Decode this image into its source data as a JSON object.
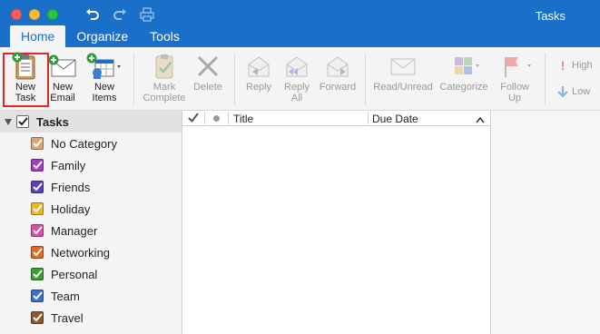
{
  "window": {
    "title": "Tasks"
  },
  "tabs": [
    {
      "label": "Home",
      "active": true
    },
    {
      "label": "Organize",
      "active": false
    },
    {
      "label": "Tools",
      "active": false
    }
  ],
  "ribbon": {
    "new_task": {
      "line1": "New",
      "line2": "Task",
      "icon": "new-task-icon"
    },
    "new_email": {
      "line1": "New",
      "line2": "Email",
      "icon": "new-email-icon"
    },
    "new_items": {
      "line1": "New",
      "line2": "Items",
      "icon": "new-items-icon"
    },
    "mark_complete": {
      "line1": "Mark",
      "line2": "Complete",
      "icon": "clipboard-check-icon"
    },
    "delete": {
      "line1": "Delete",
      "icon": "delete-x-icon"
    },
    "reply": {
      "line1": "Reply",
      "icon": "reply-icon"
    },
    "reply_all": {
      "line1": "Reply",
      "line2": "All",
      "icon": "reply-all-icon"
    },
    "forward": {
      "line1": "Forward",
      "icon": "forward-icon"
    },
    "read_unread": {
      "line1": "Read/Unread",
      "icon": "envelope-icon"
    },
    "categorize": {
      "line1": "Categorize",
      "icon": "categorize-icon"
    },
    "follow_up": {
      "line1": "Follow",
      "line2": "Up",
      "icon": "flag-icon"
    },
    "high": {
      "label": "High",
      "icon": "exclamation-icon"
    },
    "low": {
      "label": "Low",
      "icon": "down-arrow-icon"
    }
  },
  "sidebar": {
    "header": "Tasks",
    "items": [
      {
        "label": "No Category",
        "color": "#d8a675"
      },
      {
        "label": "Family",
        "color": "#a23cc1"
      },
      {
        "label": "Friends",
        "color": "#5b3fbf"
      },
      {
        "label": "Holiday",
        "color": "#e8b928"
      },
      {
        "label": "Manager",
        "color": "#d94fa6"
      },
      {
        "label": "Networking",
        "color": "#e06c24"
      },
      {
        "label": "Personal",
        "color": "#3a9f2e"
      },
      {
        "label": "Team",
        "color": "#3e6fc8"
      },
      {
        "label": "Travel",
        "color": "#8b5a2b"
      }
    ]
  },
  "list": {
    "columns": {
      "title": "Title",
      "due_date": "Due Date"
    }
  },
  "colors": {
    "accent": "#1a6fc9",
    "selection_outline": "#e02727"
  }
}
